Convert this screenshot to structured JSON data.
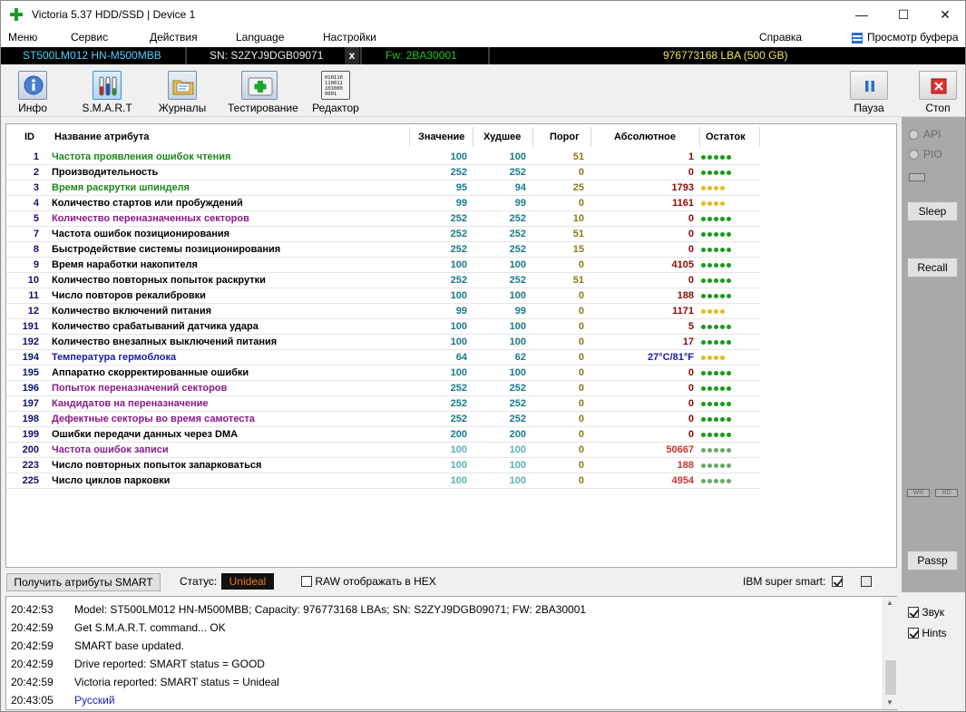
{
  "window": {
    "title": "Victoria 5.37 HDD/SSD | Device 1",
    "controls": {
      "minimize": "—",
      "maximize": "☐",
      "close": "✕"
    }
  },
  "menu": {
    "items": [
      "Меню",
      "Сервис",
      "Действия",
      "Language",
      "Настройки",
      "Справка"
    ],
    "buffer_view": "Просмотр буфера"
  },
  "device_info": {
    "model": "ST500LM012 HN-M500MBB",
    "serial": "SN: S2ZYJ9DGB09071",
    "close_mark": "x",
    "firmware": "Fw: 2BA30001",
    "capacity": "976773168 LBA (500 GB)"
  },
  "toolbar": {
    "buttons": [
      "Инфо",
      "S.M.A.R.T",
      "Журналы",
      "Тестирование",
      "Редактор"
    ],
    "active": "S.M.A.R.T",
    "pause": "Пауза",
    "stop": "Стоп",
    "editor_icon_text": "010110 110011 101000 0001"
  },
  "smart_table": {
    "columns": [
      "ID",
      "Название атрибута",
      "Значение",
      "Худшее",
      "Порог",
      "Абсолютное",
      "Остаток"
    ],
    "colors": {
      "green": "#1a8a1a",
      "purple": "#8a1a8a",
      "blue": "#1a1aa8",
      "black": "#000000",
      "good_dot": "#1a9a1a",
      "warn_dot": "#e8b820",
      "dim_dot": "#6aa86a"
    },
    "rows": [
      {
        "id": "1",
        "name": "Частота проявления ошибок чтения",
        "value": "100",
        "worst": "100",
        "threshold": "51",
        "raw": "1",
        "health": 5,
        "dot": "good",
        "color": "green"
      },
      {
        "id": "2",
        "name": "Производительность",
        "value": "252",
        "worst": "252",
        "threshold": "0",
        "raw": "0",
        "health": 5,
        "dot": "good",
        "color": "black"
      },
      {
        "id": "3",
        "name": "Время раскрутки шпинделя",
        "value": "95",
        "worst": "94",
        "threshold": "25",
        "raw": "1793",
        "health": 4,
        "dot": "warn",
        "color": "green"
      },
      {
        "id": "4",
        "name": "Количество стартов или пробуждений",
        "value": "99",
        "worst": "99",
        "threshold": "0",
        "raw": "1161",
        "health": 4,
        "dot": "warn",
        "color": "black"
      },
      {
        "id": "5",
        "name": "Количество переназначенных секторов",
        "value": "252",
        "worst": "252",
        "threshold": "10",
        "raw": "0",
        "health": 5,
        "dot": "good",
        "color": "purple"
      },
      {
        "id": "7",
        "name": "Частота ошибок позиционирования",
        "value": "252",
        "worst": "252",
        "threshold": "51",
        "raw": "0",
        "health": 5,
        "dot": "good",
        "color": "black"
      },
      {
        "id": "8",
        "name": "Быстродействие системы позиционирования",
        "value": "252",
        "worst": "252",
        "threshold": "15",
        "raw": "0",
        "health": 5,
        "dot": "good",
        "color": "black"
      },
      {
        "id": "9",
        "name": "Время наработки накопителя",
        "value": "100",
        "worst": "100",
        "threshold": "0",
        "raw": "4105",
        "health": 5,
        "dot": "good",
        "color": "black"
      },
      {
        "id": "10",
        "name": "Количество повторных попыток раскрутки",
        "value": "252",
        "worst": "252",
        "threshold": "51",
        "raw": "0",
        "health": 5,
        "dot": "good",
        "color": "black"
      },
      {
        "id": "11",
        "name": "Число повторов рекалибровки",
        "value": "100",
        "worst": "100",
        "threshold": "0",
        "raw": "188",
        "health": 5,
        "dot": "good",
        "color": "black"
      },
      {
        "id": "12",
        "name": "Количество включений питания",
        "value": "99",
        "worst": "99",
        "threshold": "0",
        "raw": "1171",
        "health": 4,
        "dot": "warn",
        "color": "black"
      },
      {
        "id": "191",
        "name": "Количество срабатываний датчика удара",
        "value": "100",
        "worst": "100",
        "threshold": "0",
        "raw": "5",
        "health": 5,
        "dot": "good",
        "color": "black"
      },
      {
        "id": "192",
        "name": "Количество внезапных выключений питания",
        "value": "100",
        "worst": "100",
        "threshold": "0",
        "raw": "17",
        "health": 5,
        "dot": "good",
        "color": "black"
      },
      {
        "id": "194",
        "name": "Температура гермоблока",
        "value": "64",
        "worst": "62",
        "threshold": "0",
        "raw": "27°C/81°F",
        "health": 4,
        "dot": "warn",
        "color": "blue"
      },
      {
        "id": "195",
        "name": "Аппаратно скорректированные ошибки",
        "value": "100",
        "worst": "100",
        "threshold": "0",
        "raw": "0",
        "health": 5,
        "dot": "good",
        "color": "black"
      },
      {
        "id": "196",
        "name": "Попыток переназначений секторов",
        "value": "252",
        "worst": "252",
        "threshold": "0",
        "raw": "0",
        "health": 5,
        "dot": "good",
        "color": "purple"
      },
      {
        "id": "197",
        "name": "Кандидатов на переназначение",
        "value": "252",
        "worst": "252",
        "threshold": "0",
        "raw": "0",
        "health": 5,
        "dot": "good",
        "color": "purple"
      },
      {
        "id": "198",
        "name": "Дефектные секторы во время самотеста",
        "value": "252",
        "worst": "252",
        "threshold": "0",
        "raw": "0",
        "health": 5,
        "dot": "good",
        "color": "purple"
      },
      {
        "id": "199",
        "name": "Ошибки передачи данных через DMA",
        "value": "200",
        "worst": "200",
        "threshold": "0",
        "raw": "0",
        "health": 5,
        "dot": "good",
        "color": "black"
      },
      {
        "id": "200",
        "name": "Частота ошибок записи",
        "value": "100",
        "worst": "100",
        "threshold": "0",
        "raw": "50667",
        "health": 5,
        "dot": "dim",
        "color": "purple"
      },
      {
        "id": "223",
        "name": "Число повторных попыток запарковаться",
        "value": "100",
        "worst": "100",
        "threshold": "0",
        "raw": "188",
        "health": 5,
        "dot": "dim",
        "color": "black"
      },
      {
        "id": "225",
        "name": "Число циклов парковки",
        "value": "100",
        "worst": "100",
        "threshold": "0",
        "raw": "4954",
        "health": 5,
        "dot": "dim",
        "color": "black"
      }
    ]
  },
  "sidebar": {
    "api": "API",
    "pio": "PIO",
    "sleep": "Sleep",
    "recall": "Recall",
    "wr": "WR",
    "rd": "RD",
    "passp": "Passp"
  },
  "status_bar": {
    "get_smart": "Получить атрибуты SMART",
    "status_label": "Статус:",
    "status_value": "Unideal",
    "raw_hex": "RAW отображать в HEX",
    "ibm": "IBM super smart:"
  },
  "log": {
    "lines": [
      {
        "time": "20:42:53",
        "text": "Model: ST500LM012 HN-M500MBB; Capacity: 976773168 LBAs; SN: S2ZYJ9DGB09071; FW: 2BA30001",
        "color": "#000000"
      },
      {
        "time": "20:42:59",
        "text": "Get S.M.A.R.T. command... OK",
        "color": "#000000"
      },
      {
        "time": "20:42:59",
        "text": "SMART base updated.",
        "color": "#000000"
      },
      {
        "time": "20:42:59",
        "text": "Drive reported: SMART status = GOOD",
        "color": "#000000"
      },
      {
        "time": "20:42:59",
        "text": "Victoria reported: SMART status = Unideal",
        "color": "#000000"
      },
      {
        "time": "20:43:05",
        "text": "Русский",
        "color": "#1a1ac8"
      }
    ],
    "sound": "Звук",
    "hints": "Hints"
  }
}
